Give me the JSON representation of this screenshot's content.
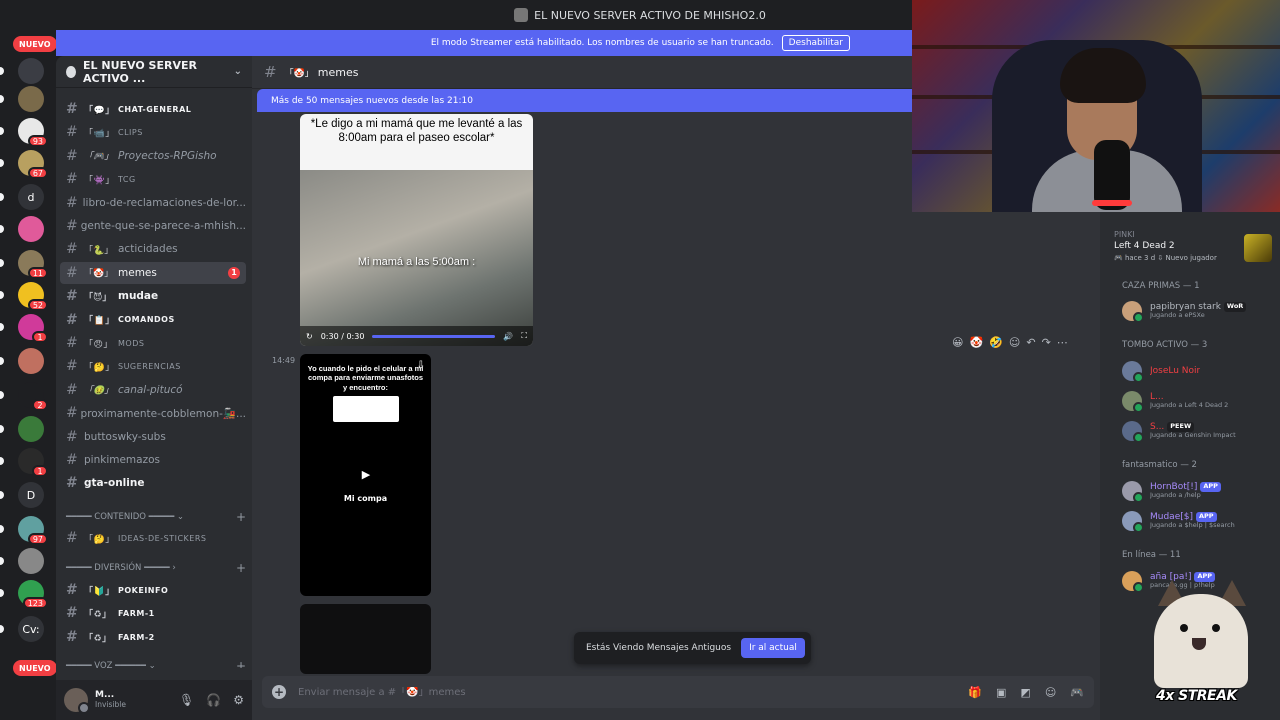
{
  "window": {
    "title": "EL NUEVO SERVER ACTIVO DE MHISHO2.0"
  },
  "streamer": {
    "text": "El modo Streamer está habilitado. Los nombres de usuario se han truncado.",
    "button": "Deshabilitar"
  },
  "rail": {
    "nuevo_top": "NUEVO",
    "nuevo_bottom": "NUEVO",
    "servers": [
      {
        "label": "",
        "badge": "",
        "color": "#3b3d44"
      },
      {
        "label": "",
        "badge": "",
        "color": "#7a6a4a"
      },
      {
        "label": "",
        "badge": "93",
        "color": "#e8e8e8"
      },
      {
        "label": "",
        "badge": "67",
        "color": "#b8a060"
      },
      {
        "label": "d",
        "badge": "",
        "color": "#313338"
      },
      {
        "label": "",
        "badge": "",
        "color": "#e05a9a"
      },
      {
        "label": "",
        "badge": "11",
        "color": "#8a7a5a"
      },
      {
        "label": "",
        "badge": "52",
        "color": "#f0c020"
      },
      {
        "label": "",
        "badge": "1",
        "color": "#d03a9a"
      },
      {
        "label": "",
        "badge": "",
        "color": "#c07060"
      },
      {
        "label": "",
        "badge": "2",
        "color": "#1e1f22"
      },
      {
        "label": "",
        "badge": "",
        "color": "#3a7a3a"
      },
      {
        "label": "",
        "badge": "1",
        "color": "#2a2a2a"
      },
      {
        "label": "D",
        "badge": "",
        "color": "#313338"
      },
      {
        "label": "",
        "badge": "97",
        "color": "#60a0a0"
      },
      {
        "label": "",
        "badge": "",
        "color": "#888"
      },
      {
        "label": "",
        "badge": "123",
        "color": "#30a050"
      },
      {
        "label": "Cv:",
        "badge": "",
        "color": "#313338"
      }
    ]
  },
  "sidebar": {
    "server_name": "EL NUEVO SERVER ACTIVO ...",
    "channels": [
      {
        "emoji": "「💬」",
        "name": "CHAT-GENERAL",
        "style": "unread small",
        "dot": true
      },
      {
        "emoji": "「📹」",
        "name": "CLIPS",
        "style": "small"
      },
      {
        "emoji": "「🎮」",
        "name": "Proyectos-RPGisho",
        "style": "italic"
      },
      {
        "emoji": "「👾」",
        "name": "TCG",
        "style": "small"
      },
      {
        "emoji": "",
        "name": "libro-de-reclamaciones-de-lor...",
        "style": ""
      },
      {
        "emoji": "",
        "name": "gente-que-se-parece-a-mhish...",
        "style": ""
      },
      {
        "emoji": "「🐍」",
        "name": "acticidades",
        "style": ""
      },
      {
        "emoji": "「🤡」",
        "name": "memes",
        "style": "active",
        "mention": "1",
        "dot": true
      },
      {
        "emoji": "「😈」",
        "name": "mudae",
        "style": "unread",
        "dot": true
      },
      {
        "emoji": "「📋」",
        "name": "COMANDOS",
        "style": "unread small",
        "dot": true
      },
      {
        "emoji": "「😠」",
        "name": "MODS",
        "style": "small"
      },
      {
        "emoji": "「🤔」",
        "name": "SUGERENCIAS",
        "style": "small"
      },
      {
        "emoji": "「🤢」",
        "name": "canal-pitucó",
        "style": "italic"
      },
      {
        "emoji": "",
        "name": "proximamente-cobblemon-🚂...",
        "style": ""
      },
      {
        "emoji": "",
        "name": "buttoswky-subs",
        "style": ""
      },
      {
        "emoji": "",
        "name": "pinkimemazos",
        "style": ""
      },
      {
        "emoji": "",
        "name": "gta-online",
        "style": "unread",
        "dot": true
      }
    ],
    "categories": [
      {
        "name": "━━━━━ CONTENIDO ━━━━━ ⌄"
      },
      {
        "name": "━━━━━ DIVERSIÓN ━━━━━ ›"
      },
      {
        "name": "━━━━━ VOZ ━━━━━━ ⌄"
      }
    ],
    "channels_after": [
      {
        "emoji": "「🤔」",
        "name": "IDEAS-DE-STICKERS",
        "style": "small"
      },
      {
        "emoji": "「🔰」",
        "name": "POKEINFO",
        "style": "unread small",
        "dot": true
      },
      {
        "emoji": "「♻」",
        "name": "FARM-1",
        "style": "unread small",
        "dot": true
      },
      {
        "emoji": "「♻」",
        "name": "FARM-2",
        "style": "unread small",
        "dot": true
      }
    ],
    "user": {
      "name": "M...",
      "status": "Invisible"
    }
  },
  "chat": {
    "channel_emoji": "「🤡」",
    "channel_name": "memes",
    "new_messages": "Más de 50 mensajes nuevos desde las 21:10",
    "video1": {
      "caption": "*Le digo a mi mamá que me levanté a las 8:00am para el paseo escolar*",
      "overlay": "Mi mamá a las 5:00am :",
      "time": "0:30 / 0:30",
      "progress": 1.0
    },
    "timestamp": "14:49",
    "video2": {
      "caption": "Yo cuando le pido el celular a mi compa para enviarme unasfotos  y encuentro:",
      "label": "Mi compa"
    },
    "jump_text": "Estás Viendo Mensajes Antiguos",
    "jump_button": "Ir al actual",
    "composer_placeholder": "Enviar mensaje a #「🤡」memes"
  },
  "members": {
    "activity": {
      "user": "PINKI",
      "game": "Left 4 Dead 2",
      "meta": "🎮 hace 3 d  ⇩ Nuevo jugador"
    },
    "groups": [
      {
        "title": "CAZA PRIMAS — 1"
      },
      {
        "title": "TOMBO ACTIVO — 3"
      },
      {
        "title": "fantasmatico — 2"
      },
      {
        "title": "En línea — 11"
      }
    ],
    "list": [
      {
        "name": "papibryan stark",
        "tag": "WoR",
        "activity": "Jugando a ePSXe",
        "color": "#b5bac1",
        "av": "#c9a07a"
      },
      {
        "name": "JoseLu Noir",
        "tag": "",
        "activity": "",
        "color": "#f23f43",
        "av": "#6a7a9a"
      },
      {
        "name": "L...",
        "tag": "",
        "activity": "Jugando a Left 4 Dead 2",
        "color": "#f23f43",
        "av": "#7a8a6a"
      },
      {
        "name": "S...",
        "tag": "PEEW",
        "activity": "Jugando a Genshin Impact",
        "color": "#f23f43",
        "av": "#5a6a8a"
      },
      {
        "name": "HornBot[!]",
        "tag": "APP",
        "activity": "Jugando a /help",
        "color": "#a78bfa",
        "av": "#9a9aaa"
      },
      {
        "name": "Mudae[$]",
        "tag": "APP",
        "activity": "Jugando a $help | $search",
        "color": "#a78bfa",
        "av": "#8a9aba"
      },
      {
        "name": "aña [pa!]",
        "tag": "APP",
        "activity": "pancake.gg | p!help",
        "color": "#a78bfa",
        "av": "#d9a05a"
      }
    ]
  },
  "overlay": {
    "streak": "4x STREAK"
  }
}
